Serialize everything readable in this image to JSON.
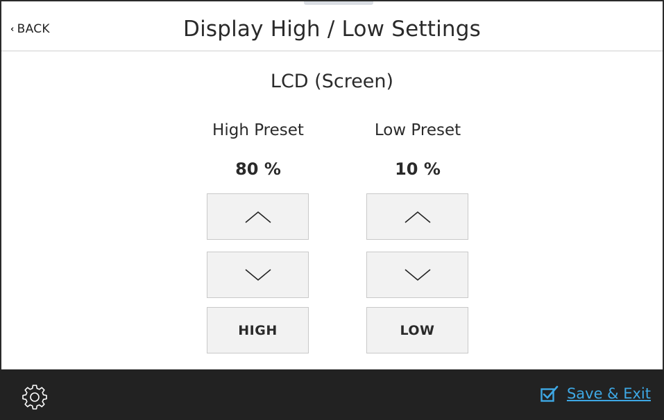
{
  "header": {
    "back_label": "BACK",
    "title": "Display High / Low Settings"
  },
  "section": {
    "title": "LCD (Screen)"
  },
  "high": {
    "label": "High Preset",
    "value": "80 %",
    "set_button_label": "HIGH"
  },
  "low": {
    "label": "Low Preset",
    "value": "10 %",
    "set_button_label": "LOW"
  },
  "icons": {
    "back": "chevron-left-icon",
    "increase": "chevron-up-icon",
    "decrease": "chevron-down-icon",
    "settings": "gear-icon",
    "save": "checkbox-checked-icon"
  },
  "footer": {
    "save_label": "Save & Exit"
  },
  "colors": {
    "accent": "#3ea8e5",
    "footer_bg": "#222222",
    "button_bg": "#f2f2f2"
  }
}
